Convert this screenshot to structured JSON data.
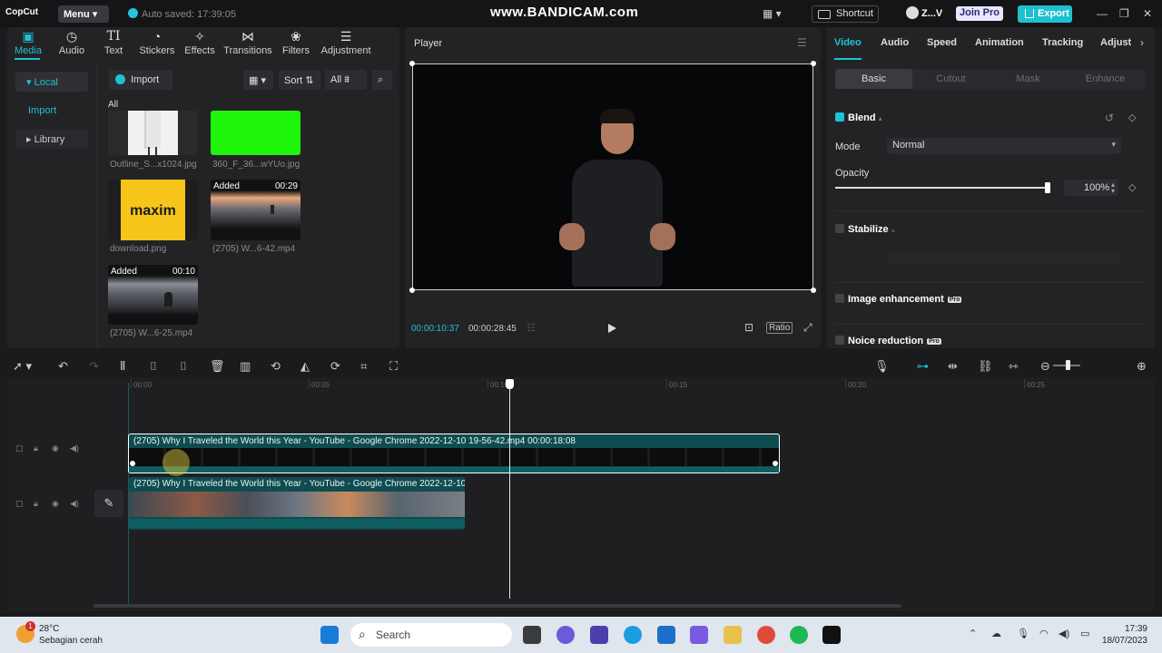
{
  "titlebar": {
    "app_name": "CopCut",
    "menu_label": "Menu",
    "autosaved": "Auto saved: 17:39:05",
    "watermark": "www.BANDICAM.com",
    "shortcut_label": "Shortcut",
    "user_name": "Z...V",
    "join_pro": "Join Pro",
    "export_label": "Export"
  },
  "media_tabs": [
    {
      "label": "Media",
      "icon": "media-icon"
    },
    {
      "label": "Audio",
      "icon": "audio-icon"
    },
    {
      "label": "Text",
      "icon": "text-icon"
    },
    {
      "label": "Stickers",
      "icon": "stickers-icon"
    },
    {
      "label": "Effects",
      "icon": "effects-icon"
    },
    {
      "label": "Transitions",
      "icon": "transitions-icon"
    },
    {
      "label": "Filters",
      "icon": "filters-icon"
    },
    {
      "label": "Adjustment",
      "icon": "adjustment-icon"
    }
  ],
  "sidebar": {
    "local": "Local",
    "import": "Import",
    "library": "Library"
  },
  "media_toolbar": {
    "import_label": "Import",
    "sort_label": "Sort",
    "all_filter": "All",
    "all_heading": "All"
  },
  "media_items": [
    {
      "caption": "Outline_S...x1024.jpg"
    },
    {
      "caption": "360_F_36...wYUo.jpg"
    },
    {
      "caption": "download.png",
      "logo_text": "maxim"
    },
    {
      "caption": "(2705) W...6-42.mp4",
      "added": "Added",
      "duration": "00:29"
    },
    {
      "caption": "(2705) W...6-25.mp4",
      "added": "Added",
      "duration": "00:10"
    }
  ],
  "player": {
    "title": "Player",
    "current_time": "00:00:10:37",
    "total_time": "00:00:28:45",
    "ratio_label": "Ratio"
  },
  "props": {
    "tabs": [
      "Video",
      "Audio",
      "Speed",
      "Animation",
      "Tracking",
      "Adjust"
    ],
    "subtabs": [
      "Basic",
      "Cutout",
      "Mask",
      "Enhance"
    ],
    "blend_label": "Blend",
    "mode_label": "Mode",
    "mode_value": "Normal",
    "opacity_label": "Opacity",
    "opacity_value": "100%",
    "opacity_fraction": 1.0,
    "stabilize_label": "Stabilize",
    "image_enhancement_label": "Image enhancement",
    "noise_reduction_label": "Noice reduction",
    "pro_tag": "Pro"
  },
  "timeline": {
    "ruler_ticks": [
      "00:00",
      "00:05",
      "00:10",
      "00:15",
      "00:20",
      "00:25"
    ],
    "clip1_label": "(2705) Why I Traveled the World this Year - YouTube - Google Chrome 2022-12-10 19-56-42.mp4   00:00:18:08",
    "clip2_label": "(2705) Why I Traveled the World this Year - YouTube - Google Chrome 2022-12-10"
  },
  "taskbar": {
    "weather_temp": "28°C",
    "weather_desc": "Sebagian cerah",
    "weather_badge": "1",
    "search_label": "Search",
    "time": "17:39",
    "date": "18/07/2023"
  },
  "colors": {
    "accent": "#1fc2d4",
    "clip": "#0f4c4f",
    "panel": "#232326",
    "background": "#1b1b1d"
  }
}
